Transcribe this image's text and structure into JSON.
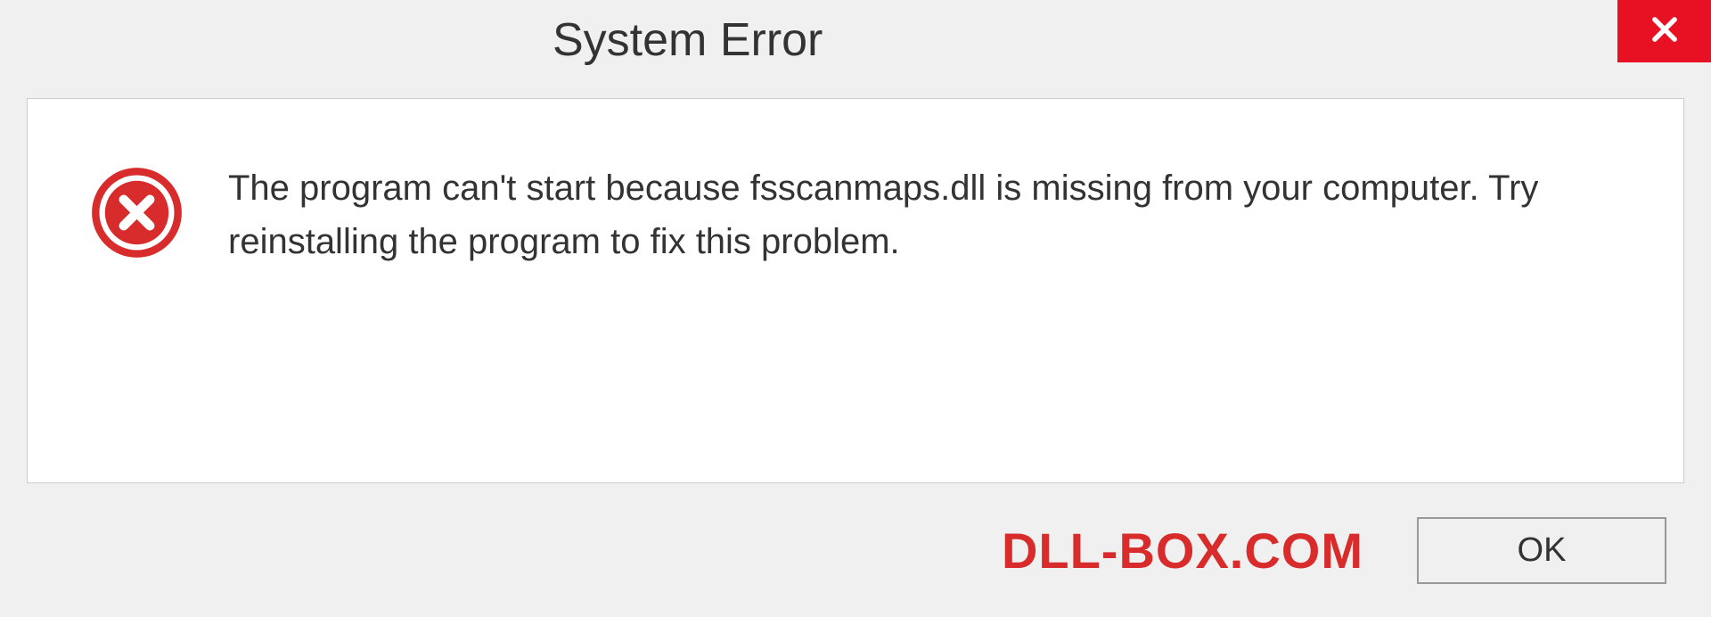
{
  "dialog": {
    "title": "System Error",
    "message": "The program can't start because fsscanmaps.dll is missing from your computer. Try reinstalling the program to fix this problem.",
    "ok_label": "OK"
  },
  "watermark": "DLL-BOX.COM",
  "colors": {
    "close_bg": "#e81123",
    "error_icon": "#d82c2c",
    "watermark": "#d82c2c"
  }
}
